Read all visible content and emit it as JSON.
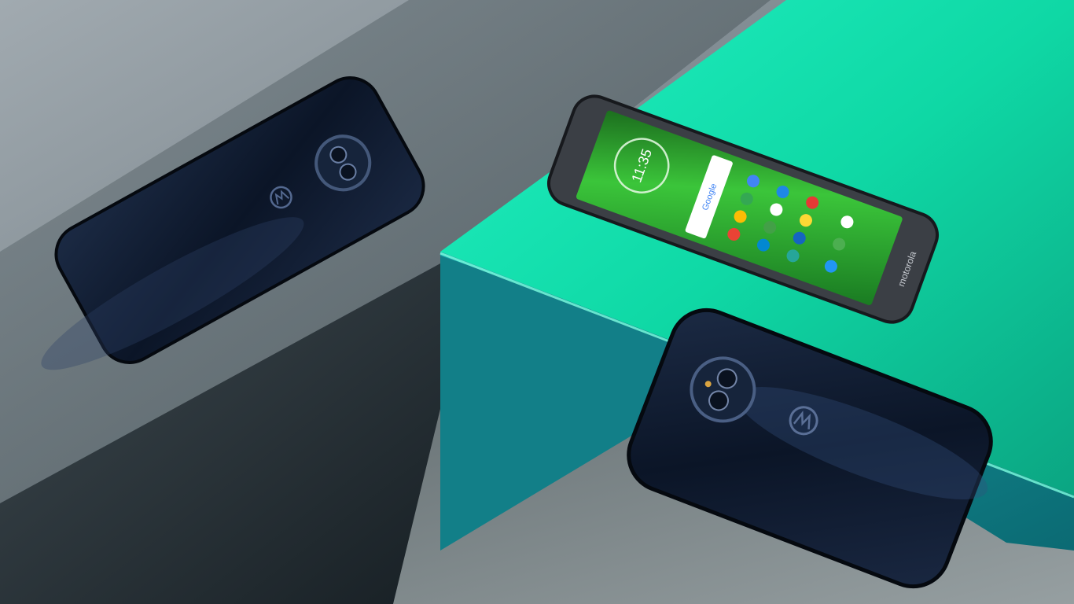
{
  "scene": {
    "colors": {
      "backdrop_grey": "#6e7a80",
      "left_block_top": "#5a666b",
      "left_block_face": "#2a3338",
      "teal_top": "#1de7b6",
      "teal_face": "#149a9a",
      "concrete": "#7d878a",
      "phone_navy": "#0f1a2e",
      "screen_green": "#2cb52a"
    },
    "phone_screen": {
      "clock": "11:35",
      "search_logo": "Google",
      "brand": "motorola"
    }
  }
}
